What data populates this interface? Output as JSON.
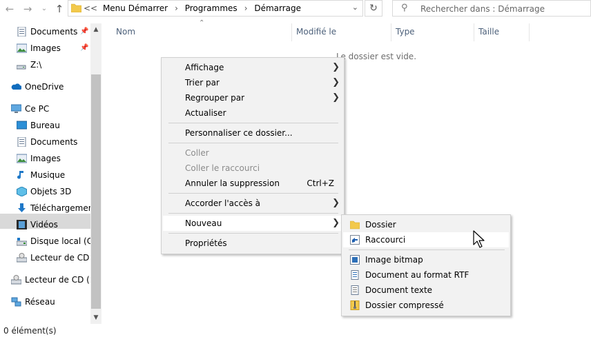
{
  "address": {
    "crumbs": [
      "Menu Démarrer",
      "Programmes",
      "Démarrage"
    ],
    "prefix": "<<"
  },
  "search": {
    "placeholder": "Rechercher dans : Démarrage"
  },
  "sidebar": {
    "items": [
      {
        "label": "Documents"
      },
      {
        "label": "Images"
      },
      {
        "label": "Z:\\"
      },
      {
        "label": "OneDrive"
      },
      {
        "label": "Ce PC"
      },
      {
        "label": "Bureau"
      },
      {
        "label": "Documents"
      },
      {
        "label": "Images"
      },
      {
        "label": "Musique"
      },
      {
        "label": "Objets 3D"
      },
      {
        "label": "Téléchargements"
      },
      {
        "label": "Vidéos"
      },
      {
        "label": "Disque local (C:)"
      },
      {
        "label": "Lecteur de CD (D"
      },
      {
        "label": "Lecteur de CD (D:)"
      },
      {
        "label": "Réseau"
      }
    ]
  },
  "columns": {
    "name": "Nom",
    "modified": "Modifié le",
    "type": "Type",
    "size": "Taille"
  },
  "empty_message": "Le dossier est vide.",
  "status": "0 élément(s)",
  "context_menu": {
    "items": {
      "view": "Affichage",
      "sort": "Trier par",
      "group": "Regrouper par",
      "refresh": "Actualiser",
      "customize": "Personnaliser ce dossier...",
      "paste": "Coller",
      "paste_shortcut": "Coller le raccourci",
      "undo_delete": "Annuler la suppression",
      "undo_shortcut": "Ctrl+Z",
      "share": "Accorder l'accès à",
      "new": "Nouveau",
      "properties": "Propriétés"
    }
  },
  "submenu": {
    "items": {
      "folder": "Dossier",
      "shortcut": "Raccourci",
      "bitmap": "Image bitmap",
      "rtf": "Document au format RTF",
      "text": "Document texte",
      "zip": "Dossier compressé"
    }
  },
  "colors": {
    "folder": "#f2c94c",
    "selection": "#d9d9d9",
    "accent": "#0078d7"
  }
}
